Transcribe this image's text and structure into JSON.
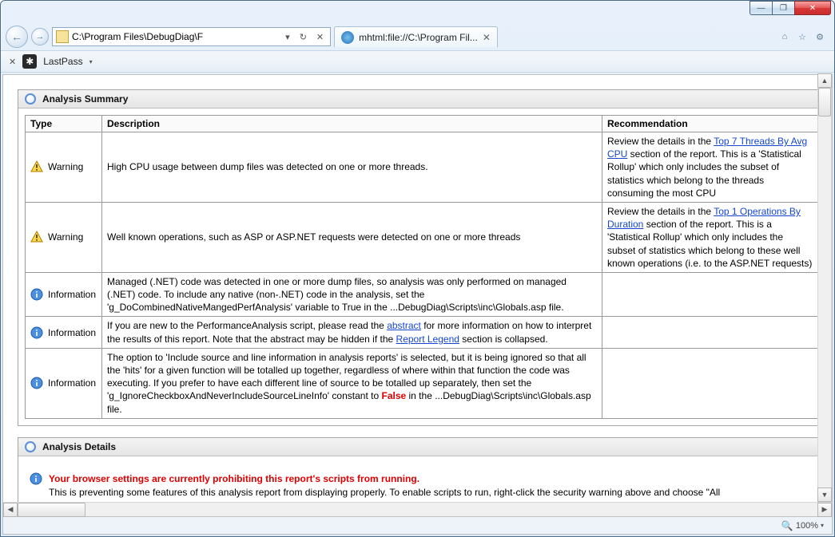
{
  "window": {
    "min": "—",
    "max": "❐",
    "close": "✕"
  },
  "nav": {
    "back_glyph": "←",
    "fwd_glyph": "→",
    "address": "C:\\Program Files\\DebugDiag\\F",
    "dropdown": "▾",
    "refresh": "↻",
    "stop": "✕",
    "home_glyph": "⌂",
    "star_glyph": "☆",
    "gear_glyph": "⚙"
  },
  "tab": {
    "label": "mhtml:file://C:\\Program Fil...",
    "close": "✕"
  },
  "toolbar2": {
    "close": "✕",
    "lastpass_glyph": "✱",
    "lastpass_label": "LastPass",
    "dropdown": "▾"
  },
  "report": {
    "summary_title": "Analysis Summary",
    "details_title": "Analysis Details",
    "cols": {
      "c1": "Type",
      "c2": "Description",
      "c3": "Recommendation"
    },
    "rows": [
      {
        "type_label": "Warning",
        "icon": "warn",
        "desc": "High CPU usage between dump files was detected on one or more threads.",
        "rec_pre": "Review the details in the ",
        "rec_link": "Top 7 Threads By Avg CPU",
        "rec_post": " section of the report. This is a 'Statistical Rollup' which only includes the subset of statistics which belong to the threads consuming the most CPU"
      },
      {
        "type_label": "Warning",
        "icon": "warn",
        "desc": "Well known operations, such as ASP or ASP.NET requests were detected on one or more threads",
        "rec_pre": "Review the details in the ",
        "rec_link": "Top 1 Operations By Duration",
        "rec_post": " section of the report. This is a 'Statistical Rollup' which only includes the subset of statistics which belong to these well known operations (i.e. to the ASP.NET requests)"
      },
      {
        "type_label": "Information",
        "icon": "info",
        "desc": "Managed (.NET) code was detected in one or more dump files, so analysis was only performed on managed (.NET) code. To include any native (non-.NET) code in the analysis, set the 'g_DoCombinedNativeMangedPerfAnalysis' variable to True in the ...DebugDiag\\Scripts\\inc\\Globals.asp file.",
        "rec_pre": "",
        "rec_link": "",
        "rec_post": ""
      },
      {
        "type_label": "Information",
        "icon": "info",
        "desc_pre": "If you are new to the PerformanceAnalysis script, please read the ",
        "desc_link1": "abstract",
        "desc_mid": " for more information on how to interpret the results of this report.   Note that the abstract may be hidden if the ",
        "desc_link2": "Report Legend",
        "desc_post": " section is collapsed.",
        "rec_pre": "",
        "rec_link": "",
        "rec_post": ""
      },
      {
        "type_label": "Information",
        "icon": "info",
        "desc_pre": "The option to 'Include source and line information in analysis reports' is selected, but it is being ignored so that all the 'hits' for a given function will be totalled up together, regardless of where within that function the code was executing. If you prefer to have each different line of source to be totalled up separately, then set the 'g_IgnoreCheckboxAndNeverIncludeSourceLineInfo' constant to ",
        "desc_red": "False",
        "desc_post": " in the ...DebugDiag\\Scripts\\inc\\Globals.asp file.",
        "rec_pre": "",
        "rec_link": "",
        "rec_post": ""
      }
    ],
    "details": {
      "headline": "Your browser settings are currently prohibiting this report's scripts from running.",
      "body": "This is preventing some features of this analysis report from displaying properly. To enable scripts to run, right-click the security warning above and choose \"All"
    }
  },
  "status": {
    "zoom": "100%",
    "zoom_glyph": "🔍",
    "dd": "▾"
  },
  "scroll": {
    "left": "◀",
    "right": "▶",
    "up": "▲",
    "down": "▼"
  }
}
